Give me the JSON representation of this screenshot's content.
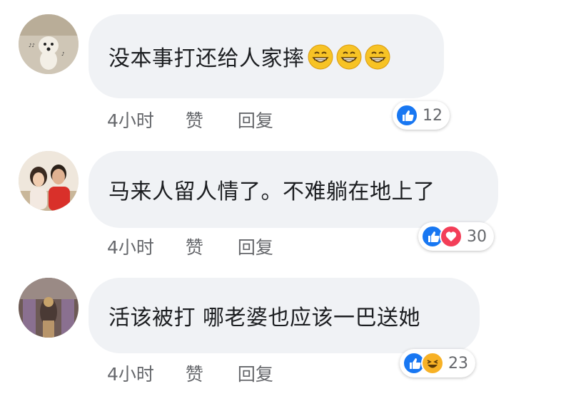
{
  "comments": [
    {
      "text": "没本事打还给人家摔",
      "emojis": [
        "grinning-face",
        "grinning-face",
        "grinning-face"
      ],
      "time": "4小时",
      "like_label": "赞",
      "reply_label": "回复",
      "reactions": [
        "like"
      ],
      "reaction_count": "12"
    },
    {
      "text": "马来人留人情了。不难躺在地上了",
      "emojis": [],
      "time": "4小时",
      "like_label": "赞",
      "reply_label": "回复",
      "reactions": [
        "like",
        "love"
      ],
      "reaction_count": "30"
    },
    {
      "text": "活该被打 哪老婆也应该一巴送她",
      "emojis": [],
      "time": "4小时",
      "like_label": "赞",
      "reply_label": "回复",
      "reactions": [
        "like",
        "haha"
      ],
      "reaction_count": "23"
    }
  ],
  "colors": {
    "like": "#1877f2",
    "love": "#f33e58",
    "haha": "#f7b125",
    "bubble": "#f0f2f5",
    "meta_text": "#65676b"
  }
}
